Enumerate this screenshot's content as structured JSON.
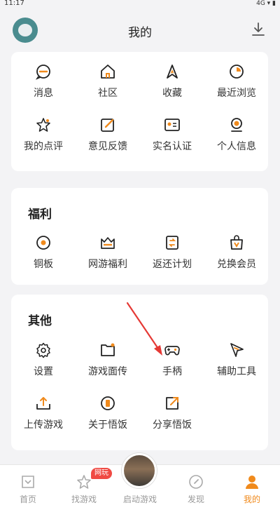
{
  "status": {
    "time": "11:17",
    "signal": "4G ▾ ▮"
  },
  "header": {
    "title": "我的"
  },
  "sections": {
    "top": {
      "items": [
        {
          "label": "消息",
          "icon": "message-icon"
        },
        {
          "label": "社区",
          "icon": "community-icon"
        },
        {
          "label": "收藏",
          "icon": "favorite-icon"
        },
        {
          "label": "最近浏览",
          "icon": "history-icon"
        },
        {
          "label": "我的点评",
          "icon": "review-icon"
        },
        {
          "label": "意见反馈",
          "icon": "feedback-icon"
        },
        {
          "label": "实名认证",
          "icon": "id-card-icon"
        },
        {
          "label": "个人信息",
          "icon": "profile-icon"
        }
      ]
    },
    "welfare": {
      "title": "福利",
      "items": [
        {
          "label": "铜板",
          "icon": "coin-icon"
        },
        {
          "label": "网游福利",
          "icon": "gift-box-icon"
        },
        {
          "label": "返还计划",
          "icon": "rebate-icon"
        },
        {
          "label": "兑换会员",
          "icon": "vip-bag-icon"
        }
      ]
    },
    "other": {
      "title": "其他",
      "items": [
        {
          "label": "设置",
          "icon": "gear-icon"
        },
        {
          "label": "游戏面传",
          "icon": "folder-icon"
        },
        {
          "label": "手柄",
          "icon": "gamepad-icon"
        },
        {
          "label": "辅助工具",
          "icon": "tool-icon"
        },
        {
          "label": "上传游戏",
          "icon": "upload-icon"
        },
        {
          "label": "关于悟饭",
          "icon": "about-icon"
        },
        {
          "label": "分享悟饭",
          "icon": "share-icon"
        }
      ]
    }
  },
  "tabbar": {
    "tabs": [
      {
        "label": "首页",
        "icon": "home-icon"
      },
      {
        "label": "找游戏",
        "icon": "star-icon"
      },
      {
        "label": "启动游戏",
        "icon": "launch-game-icon"
      },
      {
        "label": "发现",
        "icon": "compass-icon"
      },
      {
        "label": "我的",
        "icon": "user-icon"
      }
    ],
    "badge": "网玩",
    "active": "我的"
  },
  "colors": {
    "accent": "#f08a1c",
    "text": "#333333",
    "background": "#f3f3f5",
    "arrow": "#e53935"
  }
}
